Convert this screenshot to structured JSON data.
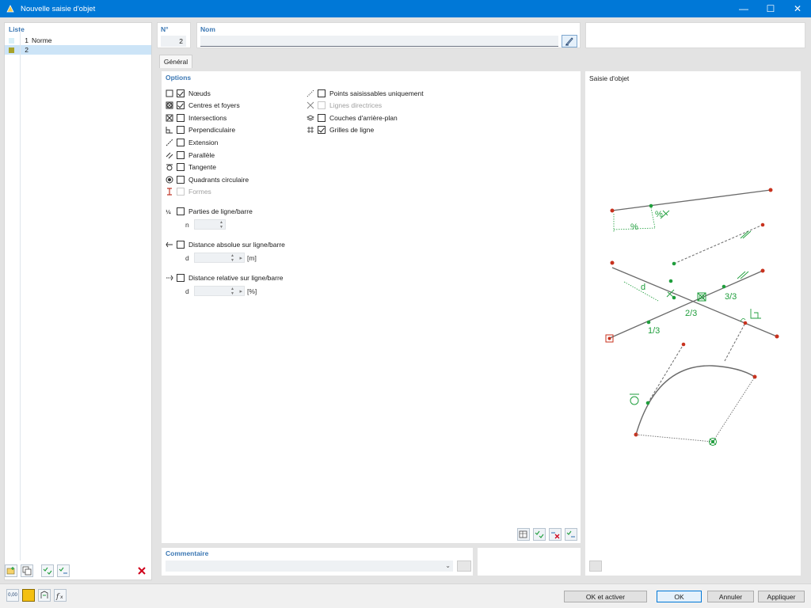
{
  "window": {
    "title": "Nouvelle saisie d'objet",
    "minimize_glyph": "—",
    "maximize_glyph": "☐",
    "close_glyph": "✕"
  },
  "list": {
    "header": "Liste",
    "items": [
      {
        "num": "1",
        "label": "Norme",
        "color": "#d8f0f8"
      },
      {
        "num": "2",
        "label": "",
        "color": "#a7a22a"
      }
    ]
  },
  "number": {
    "header": "N°",
    "value": "2"
  },
  "name": {
    "header": "Nom",
    "value": ""
  },
  "tabs": [
    {
      "label": "Général"
    }
  ],
  "options": {
    "header": "Options",
    "left": [
      {
        "label": "Nœuds",
        "checked": true,
        "icon": "node-icon"
      },
      {
        "label": "Centres et foyers",
        "checked": true,
        "icon": "center-icon"
      },
      {
        "label": "Intersections",
        "checked": false,
        "icon": "intersection-icon"
      },
      {
        "label": "Perpendiculaire",
        "checked": false,
        "icon": "perpendicular-icon"
      },
      {
        "label": "Extension",
        "checked": false,
        "icon": "extension-icon"
      },
      {
        "label": "Parallèle",
        "checked": false,
        "icon": "parallel-icon"
      },
      {
        "label": "Tangente",
        "checked": false,
        "icon": "tangent-icon"
      },
      {
        "label": "Quadrants circulaire",
        "checked": false,
        "icon": "quadrant-icon"
      },
      {
        "label": "Formes",
        "checked": false,
        "icon": "shapes-icon",
        "disabled": true
      }
    ],
    "right": [
      {
        "label": "Points saisissables uniquement",
        "checked": false,
        "icon": "snap-points-icon"
      },
      {
        "label": "Lignes directrices",
        "checked": false,
        "icon": "guidelines-icon",
        "disabled": true
      },
      {
        "label": "Couches d'arrière-plan",
        "checked": false,
        "icon": "background-layers-icon"
      },
      {
        "label": "Grilles de ligne",
        "checked": true,
        "icon": "line-grid-icon"
      }
    ],
    "line_parts": {
      "label": "Parties de ligne/barre",
      "checked": false,
      "n_label": "n"
    },
    "abs_distance": {
      "label": "Distance absolue sur ligne/barre",
      "checked": false,
      "d_label": "d",
      "unit": "[m]"
    },
    "rel_distance": {
      "label": "Distance relative sur ligne/barre",
      "checked": false,
      "d_label": "d",
      "unit": "[%]"
    }
  },
  "comment": {
    "header": "Commentaire",
    "value": ""
  },
  "preview": {
    "header": "Saisie d'objet",
    "labels": {
      "percent": "%",
      "d": "d",
      "third1": "1/3",
      "third2": "2/3",
      "third3": "3/3"
    }
  },
  "buttons": {
    "ok_activate": "OK et activer",
    "ok": "OK",
    "cancel": "Annuler",
    "apply": "Appliquer"
  },
  "bottom_tools": {
    "units_label": "0,00"
  },
  "colors": {
    "accent": "#0078d7",
    "header_blue": "#3c78b4",
    "green": "#1f9e3c",
    "red": "#c8321e"
  }
}
